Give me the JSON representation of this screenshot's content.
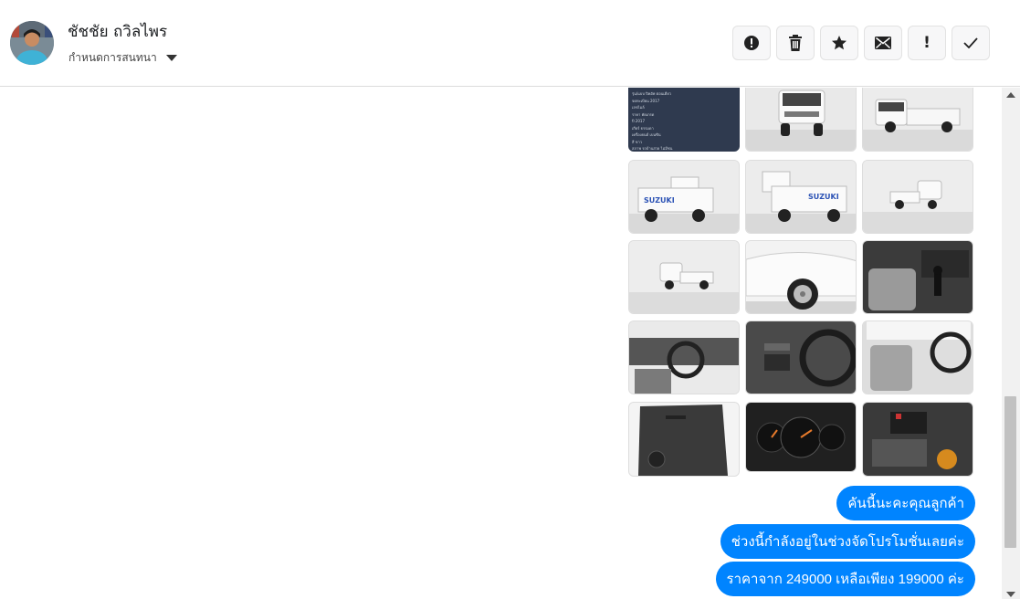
{
  "contact": {
    "name": "ชัชชัย ถวิลไพร",
    "conversation_setting": "กำหนดการสนทนา"
  },
  "toolbar": {
    "buttons": [
      {
        "icon": "alert-circle-icon"
      },
      {
        "icon": "trash-icon"
      },
      {
        "icon": "star-icon"
      },
      {
        "icon": "envelope-icon"
      },
      {
        "icon": "exclamation-icon",
        "label": "!"
      },
      {
        "icon": "check-icon"
      }
    ]
  },
  "spec_sheet": {
    "rows": [
      {
        "k": "รุ่น/แบบ",
        "v": "ปิคอัพ ตอนเดียว"
      },
      {
        "k": "จดทะเบียน",
        "v": "2017"
      },
      {
        "k": "เลขไมล์",
        "v": ""
      },
      {
        "k": "ราคา",
        "v": "คัดเกรด"
      },
      {
        "k": "ปี",
        "v": "2017"
      },
      {
        "k": "เกียร์",
        "v": "ธรรมดา"
      },
      {
        "k": "เครื่องยนต์",
        "v": "เบนซิน"
      },
      {
        "k": "สี",
        "v": "ขาว"
      },
      {
        "k": "สภาพ",
        "v": "รถบ้านสวย ไม่มีชน"
      }
    ]
  },
  "photos": [
    {
      "name": "spec-sheet-photo"
    },
    {
      "name": "truck-front-photo"
    },
    {
      "name": "truck-front-quarter-photo"
    },
    {
      "name": "truck-rear-left-photo",
      "text": "SUZUKI"
    },
    {
      "name": "truck-rear-right-photo",
      "text": "SUZUKI"
    },
    {
      "name": "truck-side-right-photo"
    },
    {
      "name": "truck-side-left-photo"
    },
    {
      "name": "truck-wheel-photo"
    },
    {
      "name": "truck-seat-photo"
    },
    {
      "name": "truck-dashboard-photo"
    },
    {
      "name": "truck-steering-photo"
    },
    {
      "name": "truck-cabin-photo"
    },
    {
      "name": "truck-door-panel-photo"
    },
    {
      "name": "truck-gauge-photo"
    },
    {
      "name": "truck-engine-photo"
    }
  ],
  "messages": [
    {
      "text": "คันนี้นะคะคุณลูกค้า"
    },
    {
      "text": "ช่วงนี้กำลังอยู่ในช่วงจัดโปรโมชั่นเลยค่ะ"
    },
    {
      "text": "ราคาจาก 249000 เหลือเพียง 199000  ค่ะ"
    }
  ],
  "colors": {
    "bubble": "#0084ff",
    "bubble_text": "#ffffff",
    "toolbar_button_bg": "#f7f7f8",
    "header_border": "#dcdcdc",
    "spec_sheet_bg": "#2f3a4f"
  }
}
